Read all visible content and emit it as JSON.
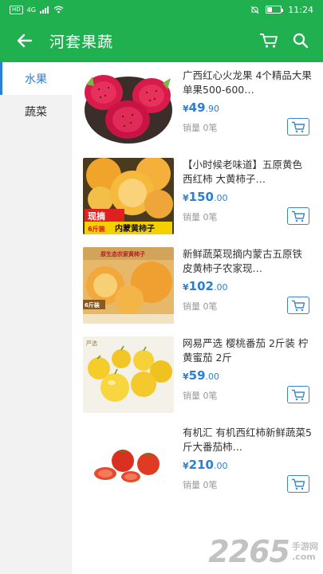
{
  "status_bar": {
    "hd": "HD",
    "signal": "4G",
    "time": "11:24"
  },
  "app_bar": {
    "title": "河套果蔬"
  },
  "sidebar": {
    "items": [
      {
        "label": "水果",
        "active": true
      },
      {
        "label": "蔬菜",
        "active": false
      }
    ]
  },
  "products": [
    {
      "title": "广西红心火龙果 4个精品大果 单果500-600…",
      "currency": "¥",
      "price_int": "49",
      "price_dec": ".90",
      "sold": "销量 0笔"
    },
    {
      "title": "【小时候老味道】五原黄色西红柿 大黄柿子…",
      "currency": "¥",
      "price_int": "150",
      "price_dec": ".00",
      "sold": "销量 0笔",
      "banner": "现摘",
      "banner2": "6斤装",
      "banner3": "内蒙黄柿子"
    },
    {
      "title": "新鲜蔬菜现摘内蒙古五原铁皮黄柿子农家现…",
      "currency": "¥",
      "price_int": "102",
      "price_dec": ".00",
      "sold": "销量 0笔",
      "banner": "原生态农家黄柿子",
      "banner2": "6斤装"
    },
    {
      "title": "网易严选 樱桃番茄 2斤装 柠黄蜜茄 2斤",
      "currency": "¥",
      "price_int": "59",
      "price_dec": ".00",
      "sold": "销量 0笔",
      "banner": "严选"
    },
    {
      "title": "有机汇 有机西红柿新鲜蔬菜5斤大番茄柿…",
      "currency": "¥",
      "price_int": "210",
      "price_dec": ".00",
      "sold": "销量 0笔"
    }
  ],
  "watermark": {
    "number": "2265",
    "cn_top": "手游网",
    "cn_bottom": ".com"
  },
  "colors": {
    "primary": "#20b04f",
    "accent": "#2a7fd6"
  }
}
